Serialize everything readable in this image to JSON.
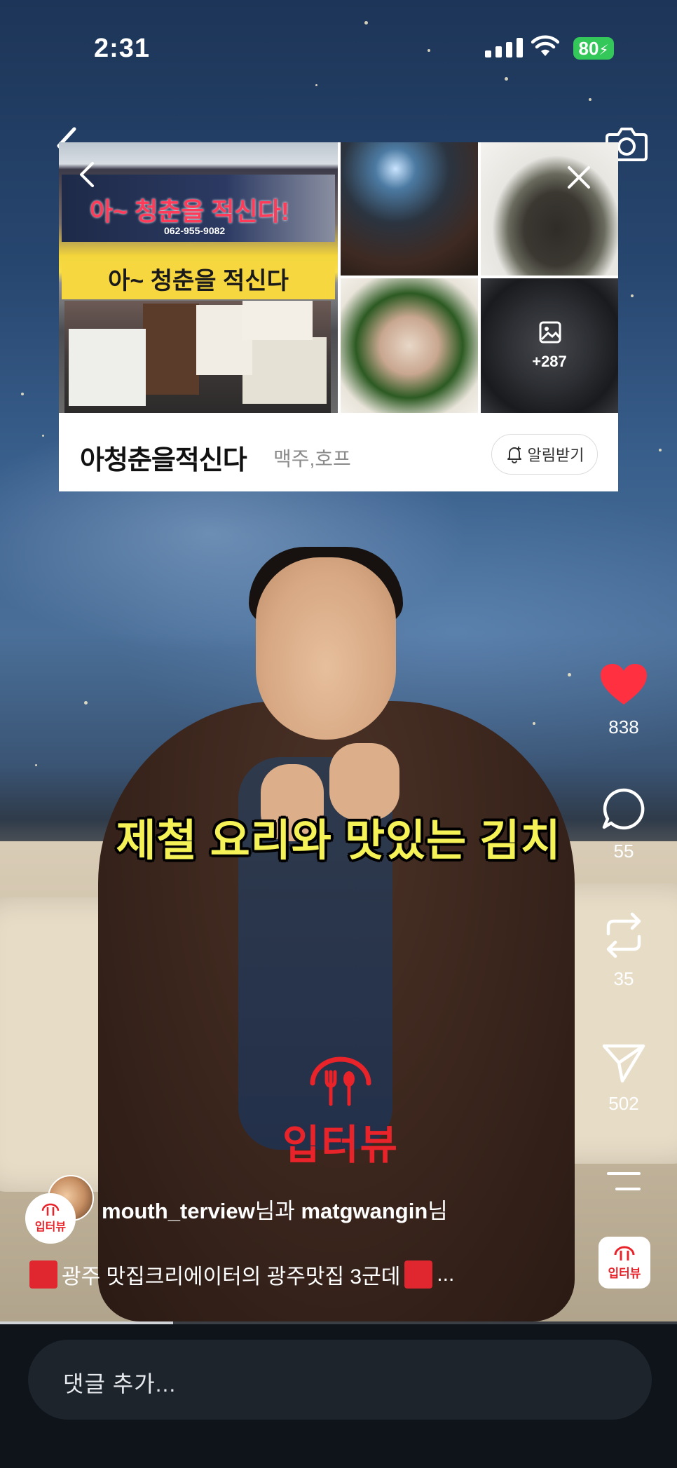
{
  "status_bar": {
    "time": "2:31",
    "battery": "80"
  },
  "place_card": {
    "sign_top_text": "아~ 청춘을 적신다!",
    "sign_phone": "062-955-9082",
    "sign_banner_text": "아~ 청춘을 적신다",
    "more_photos_count": "+287",
    "name": "아청춘을적신다",
    "category": "맥주,호프",
    "notify_label": "알림받기"
  },
  "subtitle": "제철 요리와 맛있는 김치",
  "watermark": "입터뷰",
  "actions": {
    "likes": "838",
    "comments": "55",
    "reposts": "35",
    "shares": "502",
    "like_color": "#ff3040"
  },
  "creator": {
    "user1": "mouth_terview",
    "suffix1": "님과 ",
    "user2": "matgwangin",
    "suffix2": "님",
    "avatar_label": "입터뷰"
  },
  "caption": {
    "text": "광주 맛집크리에이터의 광주맛집 3군데",
    "more": " ..."
  },
  "audio_badge_label": "입터뷰",
  "progress": 0.256,
  "comment": {
    "placeholder": "댓글 추가..."
  }
}
